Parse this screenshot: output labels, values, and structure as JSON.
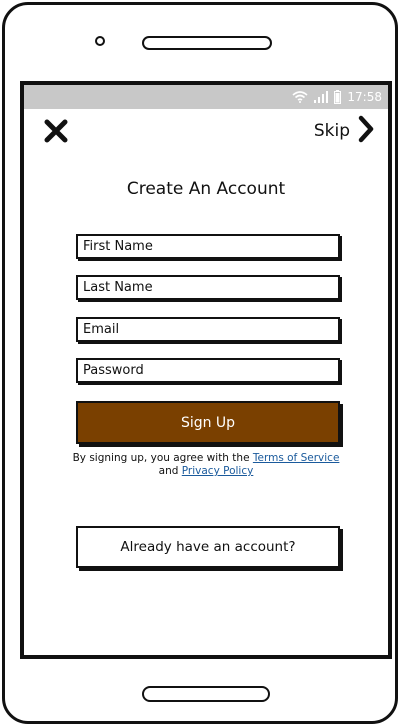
{
  "status_bar": {
    "time": "17:58"
  },
  "header": {
    "skip_label": "Skip"
  },
  "form": {
    "title": "Create An Account",
    "first_name_placeholder": "First Name",
    "last_name_placeholder": "Last Name",
    "email_placeholder": "Email",
    "password_placeholder": "Password",
    "signup_label": "Sign Up"
  },
  "terms": {
    "prefix": "By signing up, you agree with the ",
    "terms_link": "Terms of Service",
    "connector": "and ",
    "privacy_link": "Privacy Policy"
  },
  "login": {
    "label": "Already have an account?"
  },
  "colors": {
    "accent": "#7a4000",
    "link": "#1a5a9c",
    "status_bar": "#c8c8c8"
  },
  "icons": [
    "wifi-icon",
    "signal-icon",
    "battery-icon",
    "close-icon",
    "chevron-right-icon"
  ]
}
